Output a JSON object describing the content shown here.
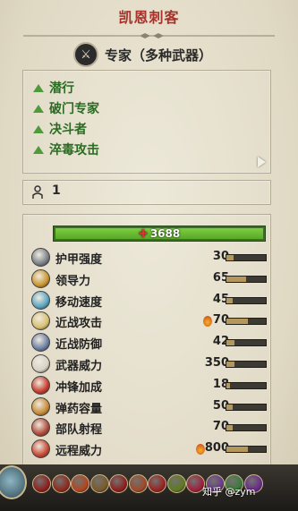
{
  "window": {
    "title": "凯恩刺客"
  },
  "role": {
    "label": "专家（多种武器）",
    "icon": "crossed-weapons-icon"
  },
  "abilities": [
    {
      "label": "潜行"
    },
    {
      "label": "破门专家"
    },
    {
      "label": "决斗者"
    },
    {
      "label": "淬毒攻击"
    }
  ],
  "unit_count": {
    "value": "1",
    "icon": "person-icon"
  },
  "health": {
    "value": "3688"
  },
  "stats": [
    {
      "label": "护甲强度",
      "value": "30",
      "fraction": 0.18,
      "icon": "armour-icon",
      "color": "#7a8088"
    },
    {
      "label": "领导力",
      "value": "65",
      "fraction": 0.5,
      "icon": "leadership-icon",
      "color": "#c9952f"
    },
    {
      "label": "移动速度",
      "value": "45",
      "fraction": 0.15,
      "icon": "speed-icon",
      "color": "#5aa4c0"
    },
    {
      "label": "近战攻击",
      "value": "70",
      "fraction": 0.55,
      "icon": "melee-attack-icon",
      "color": "#d9c070",
      "fire": true
    },
    {
      "label": "近战防御",
      "value": "42",
      "fraction": 0.2,
      "icon": "melee-defence-icon",
      "color": "#6b7ea3"
    },
    {
      "label": "武器威力",
      "value": "350",
      "fraction": 0.2,
      "icon": "weapon-strength-icon",
      "color": "#d8d2c4"
    },
    {
      "label": "冲锋加成",
      "value": "18",
      "fraction": 0.1,
      "icon": "charge-bonus-icon",
      "color": "#c83b2d"
    },
    {
      "label": "弹药容量",
      "value": "50",
      "fraction": 0.15,
      "icon": "ammunition-icon",
      "color": "#c88a36"
    },
    {
      "label": "部队射程",
      "value": "70",
      "fraction": 0.15,
      "icon": "range-icon",
      "color": "#b24a3a"
    },
    {
      "label": "远程威力",
      "value": "800",
      "fraction": 0.55,
      "icon": "missile-strength-icon",
      "color": "#c74733",
      "fire": true
    }
  ],
  "attributes": [
    {
      "icon": "attribute-icon-1",
      "color": "#8e1f1f"
    },
    {
      "icon": "attribute-icon-2",
      "color": "#8e2a1f"
    },
    {
      "icon": "attribute-icon-3",
      "color": "#b3461f"
    },
    {
      "icon": "attribute-icon-4",
      "color": "#7a5a2a"
    },
    {
      "icon": "attribute-icon-5",
      "color": "#8e1f1f"
    },
    {
      "icon": "attribute-icon-6",
      "color": "#a0492a"
    },
    {
      "icon": "attribute-icon-7",
      "color": "#9a2222"
    },
    {
      "icon": "attribute-icon-8",
      "color": "#5f7a1f"
    },
    {
      "icon": "attribute-icon-9",
      "color": "#a01f3f"
    },
    {
      "icon": "attribute-icon-10",
      "color": "#6a3a8a"
    },
    {
      "icon": "attribute-icon-11",
      "color": "#3a7a3a"
    },
    {
      "icon": "attribute-icon-12",
      "color": "#6a2a8a"
    }
  ],
  "watermark": "知乎 @zym"
}
